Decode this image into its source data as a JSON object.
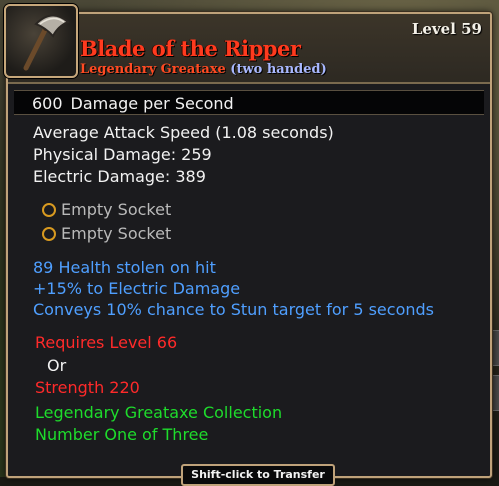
{
  "item": {
    "level_label": "Level 59",
    "name": "Blade of the Ripper",
    "rarity_type": "Legendary Greataxe",
    "handedness": "(two handed)",
    "icon": "axe-icon"
  },
  "dps": {
    "value": "600",
    "label": "Damage per Second"
  },
  "stats": [
    "Average Attack Speed (1.08 seconds)",
    "Physical Damage: 259",
    "Electric Damage: 389"
  ],
  "sockets": [
    "Empty Socket",
    "Empty Socket"
  ],
  "magic_properties": [
    "89 Health stolen on hit",
    "+15% to Electric Damage",
    "Conveys 10% chance to Stun target for 5 seconds"
  ],
  "requirements": {
    "level": "Requires Level 66",
    "or": "Or",
    "strength": "Strength 220"
  },
  "collection": [
    "Legendary Greataxe Collection",
    "Number One of Three"
  ],
  "footer_hint": "Shift-click to Transfer",
  "colors": {
    "legendary": "#ff3a1e",
    "magic": "#4f9fff",
    "requirement": "#ff2a2a",
    "set": "#1edc2c",
    "border": "#bfa27a"
  }
}
